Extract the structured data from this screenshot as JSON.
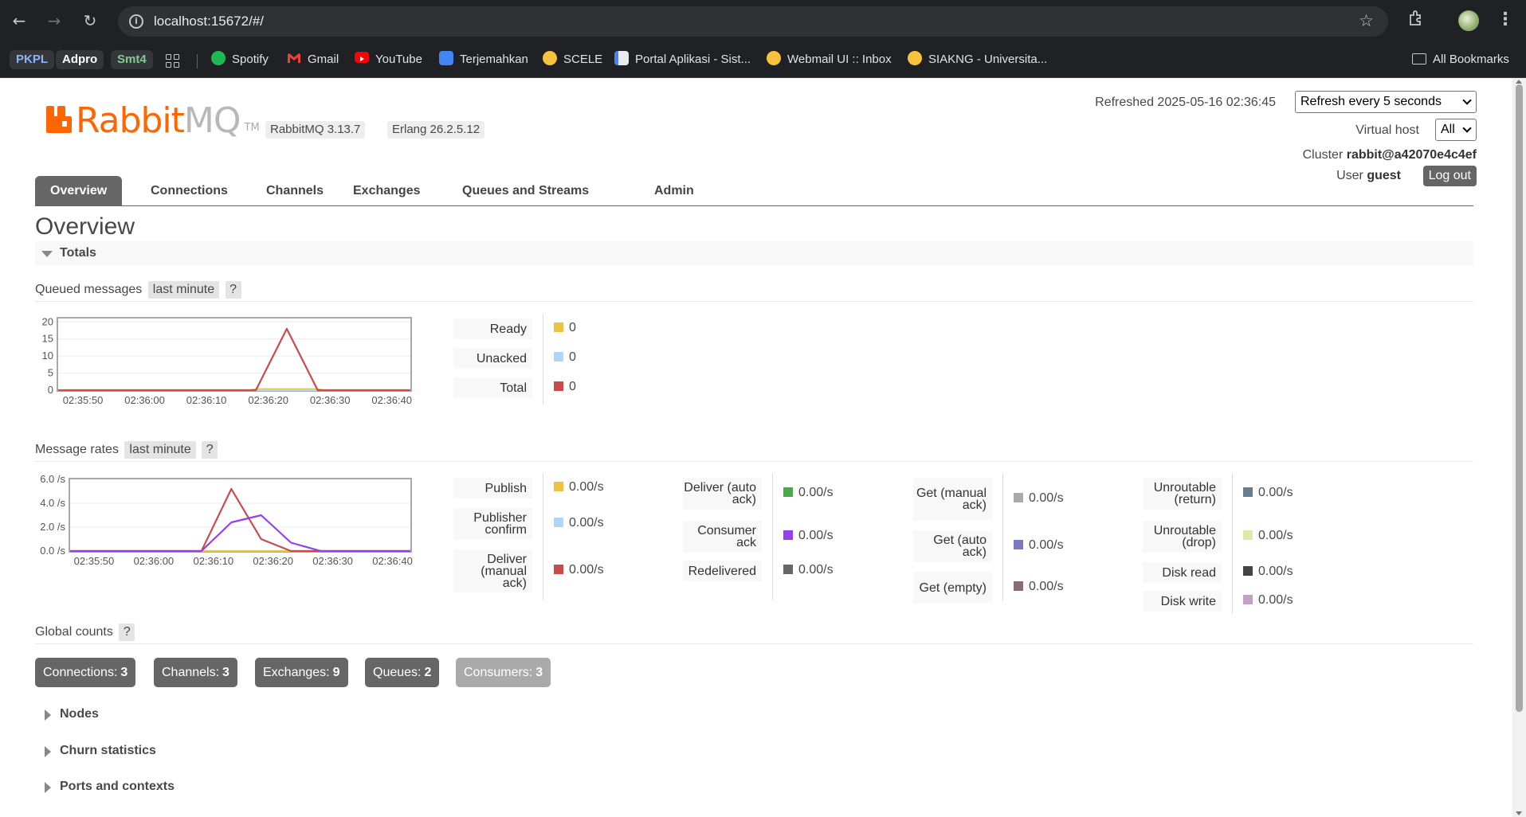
{
  "browser": {
    "url": "localhost:15672/#/",
    "bookmarks": [
      {
        "label": "PKPL"
      },
      {
        "label": "Adpro"
      },
      {
        "label": "Smt4"
      },
      {
        "label": "Spotify",
        "icon": "spotify-icon",
        "color": "#1db954"
      },
      {
        "label": "Gmail",
        "icon": "gmail-icon",
        "color": "#ea4335"
      },
      {
        "label": "YouTube",
        "icon": "youtube-icon",
        "color": "#ff0000"
      },
      {
        "label": "Terjemahkan",
        "icon": "translate-icon",
        "color": "#4285f4"
      },
      {
        "label": "SCELE",
        "icon": "scele-icon",
        "color": "#f9c23c"
      },
      {
        "label": "Portal Aplikasi - Sist...",
        "icon": "portal-icon",
        "color": "#e8eaed"
      },
      {
        "label": "Webmail UI :: Inbox",
        "icon": "ui-seal-icon",
        "color": "#f9c23c"
      },
      {
        "label": "SIAKNG - Universita...",
        "icon": "ui-seal-icon",
        "color": "#f9c23c"
      }
    ],
    "all_bookmarks": "All Bookmarks"
  },
  "header": {
    "logo_rabbit": "Rabbit",
    "logo_mq": "MQ",
    "logo_tm": "TM",
    "version": "RabbitMQ 3.13.7",
    "erlang": "Erlang 26.2.5.12",
    "refreshed_label": "Refreshed 2025-05-16 02:36:45",
    "refresh_select": "Refresh every 5 seconds",
    "vhost_label": "Virtual host",
    "vhost_value": "All",
    "cluster_label": "Cluster",
    "cluster_value": "rabbit@a42070e4c4ef",
    "user_label": "User",
    "user_value": "guest",
    "logout": "Log out"
  },
  "tabs": [
    "Overview",
    "Connections",
    "Channels",
    "Exchanges",
    "Queues and Streams",
    "Admin"
  ],
  "page_title": "Overview",
  "totals": {
    "title": "Totals",
    "queued": {
      "heading": "Queued messages",
      "range": "last minute",
      "help": "?",
      "legend": [
        {
          "label": "Ready",
          "value": "0",
          "color": "#edc240"
        },
        {
          "label": "Unacked",
          "value": "0",
          "color": "#afd8f8"
        },
        {
          "label": "Total",
          "value": "0",
          "color": "#cb4b4b"
        }
      ]
    },
    "rates": {
      "heading": "Message rates",
      "range": "last minute",
      "help": "?",
      "columns": [
        [
          {
            "label": "Publish",
            "value": "0.00/s",
            "color": "#edc240"
          },
          {
            "label": "Publisher confirm",
            "value": "0.00/s",
            "color": "#afd8f8"
          },
          {
            "label": "Deliver (manual ack)",
            "value": "0.00/s",
            "color": "#cb4b4b"
          }
        ],
        [
          {
            "label": "Deliver (auto ack)",
            "value": "0.00/s",
            "color": "#4da74d"
          },
          {
            "label": "Consumer ack",
            "value": "0.00/s",
            "color": "#9440ed"
          },
          {
            "label": "Redelivered",
            "value": "0.00/s",
            "color": "#666666"
          }
        ],
        [
          {
            "label": "Get (manual ack)",
            "value": "0.00/s",
            "color": "#aaaaaa"
          },
          {
            "label": "Get (auto ack)",
            "value": "0.00/s",
            "color": "#7c79c3"
          },
          {
            "label": "Get (empty)",
            "value": "0.00/s",
            "color": "#8d6c6c"
          }
        ],
        [
          {
            "label": "Unroutable (return)",
            "value": "0.00/s",
            "color": "#687e8c"
          },
          {
            "label": "Unroutable (drop)",
            "value": "0.00/s",
            "color": "#e6e4aa"
          },
          {
            "label": "Disk read",
            "value": "0.00/s",
            "color": "#444444"
          },
          {
            "label": "Disk write",
            "value": "0.00/s",
            "color": "#c4a0c8"
          }
        ]
      ]
    }
  },
  "global_counts": {
    "heading": "Global counts",
    "help": "?",
    "items": [
      {
        "label": "Connections:",
        "value": "3"
      },
      {
        "label": "Channels:",
        "value": "3"
      },
      {
        "label": "Exchanges:",
        "value": "9"
      },
      {
        "label": "Queues:",
        "value": "2"
      },
      {
        "label": "Consumers:",
        "value": "3"
      }
    ]
  },
  "collapsed_sections": [
    "Nodes",
    "Churn statistics",
    "Ports and contexts"
  ],
  "chart_data": [
    {
      "type": "line",
      "x": [
        "02:35:50",
        "02:36:00",
        "02:36:10",
        "02:36:20",
        "02:36:30",
        "02:36:40"
      ],
      "yticks": [
        "0",
        "5",
        "10",
        "15",
        "20"
      ],
      "ylim": [
        0,
        21
      ],
      "xlim_seconds": [
        -57,
        0
      ],
      "series": [
        {
          "name": "Ready",
          "color": "#edc240",
          "points": [
            [
              -57,
              0
            ],
            [
              -26,
              0
            ],
            [
              -25,
              0.3
            ],
            [
              -15,
              0.3
            ],
            [
              -14,
              0
            ],
            [
              0,
              0
            ]
          ]
        },
        {
          "name": "Unacked",
          "color": "#afd8f8",
          "points": [
            [
              -57,
              0
            ],
            [
              0,
              0
            ]
          ]
        },
        {
          "name": "Total",
          "color": "#cb4b4b",
          "points": [
            [
              -57,
              0
            ],
            [
              -25,
              0
            ],
            [
              -20,
              18
            ],
            [
              -15,
              0
            ],
            [
              0,
              0
            ]
          ]
        }
      ]
    },
    {
      "type": "line",
      "x": [
        "02:35:50",
        "02:36:00",
        "02:36:10",
        "02:36:20",
        "02:36:30",
        "02:36:40"
      ],
      "yticks": [
        "0.0 /s",
        "2.0 /s",
        "4.0 /s",
        "6.0 /s"
      ],
      "ylim": [
        0,
        6
      ],
      "xlim_seconds": [
        -57,
        0
      ],
      "series": [
        {
          "name": "Publish",
          "color": "#edc240",
          "points": [
            [
              -57,
              0
            ],
            [
              0,
              0
            ]
          ]
        },
        {
          "name": "Deliver (manual ack)",
          "color": "#cb4b4b",
          "points": [
            [
              -57,
              0
            ],
            [
              -35,
              0
            ],
            [
              -30,
              5.2
            ],
            [
              -25,
              1.0
            ],
            [
              -20,
              0
            ],
            [
              0,
              0
            ]
          ]
        },
        {
          "name": "Consumer ack",
          "color": "#9440ed",
          "points": [
            [
              -57,
              0
            ],
            [
              -35,
              0
            ],
            [
              -30,
              2.4
            ],
            [
              -25,
              3.0
            ],
            [
              -20,
              0.7
            ],
            [
              -15,
              0
            ],
            [
              0,
              0
            ]
          ]
        }
      ]
    }
  ]
}
